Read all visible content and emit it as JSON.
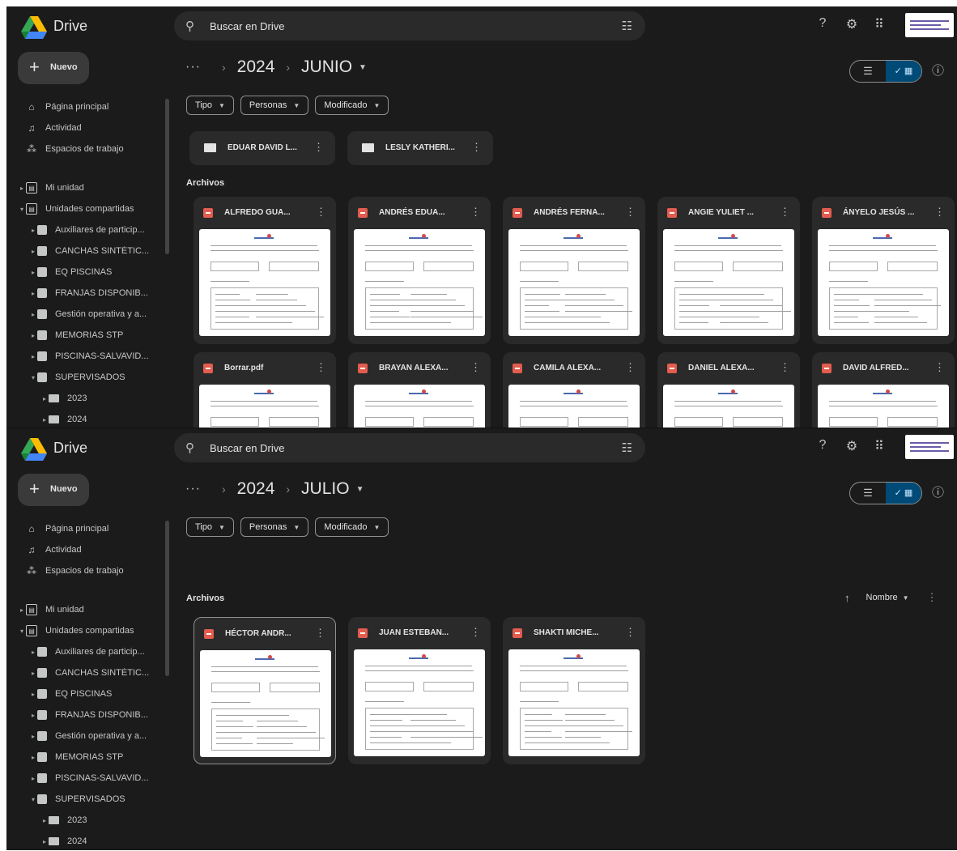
{
  "frames": [
    {
      "app_name": "Drive",
      "search_placeholder": "Buscar en Drive",
      "new_label": "Nuevo",
      "nav": [
        {
          "label": "Página principal"
        },
        {
          "label": "Actividad"
        },
        {
          "label": "Espacios de trabajo"
        }
      ],
      "my_drive": "Mi unidad",
      "shared_drives": "Unidades compartidas",
      "shared_items": [
        {
          "label": "Auxiliares de particip..."
        },
        {
          "label": "CANCHAS SINTÉTIC..."
        },
        {
          "label": "EQ PISCINAS"
        },
        {
          "label": "FRANJAS DISPONIB..."
        },
        {
          "label": "Gestión operativa y a..."
        },
        {
          "label": "MEMORIAS STP"
        },
        {
          "label": "PISCINAS-SALVAVID..."
        },
        {
          "label": "SUPERVISADOS"
        }
      ],
      "year_items": [
        {
          "label": "2023"
        },
        {
          "label": "2024"
        }
      ],
      "breadcrumb": {
        "more": "···",
        "year": "2024",
        "month": "JUNIO"
      },
      "filters": [
        {
          "label": "Tipo"
        },
        {
          "label": "Personas"
        },
        {
          "label": "Modificado"
        }
      ],
      "folders": [
        {
          "name": "EDUAR DAVID L..."
        },
        {
          "name": "LESLY KATHERI..."
        }
      ],
      "files_section": "Archivos",
      "files": [
        {
          "name": "ALFREDO GUA..."
        },
        {
          "name": "ANDRÉS EDUA..."
        },
        {
          "name": "ANDRÉS FERNA..."
        },
        {
          "name": "ANGIE YULIET ..."
        },
        {
          "name": "ÁNYELO JESÚS ..."
        },
        {
          "name": "Borrar.pdf"
        },
        {
          "name": "BRAYAN ALEXA..."
        },
        {
          "name": "CAMILA ALEXA..."
        },
        {
          "name": "DANIEL ALEXA..."
        },
        {
          "name": "DAVID ALFRED..."
        }
      ]
    },
    {
      "app_name": "Drive",
      "search_placeholder": "Buscar en Drive",
      "new_label": "Nuevo",
      "nav": [
        {
          "label": "Página principal"
        },
        {
          "label": "Actividad"
        },
        {
          "label": "Espacios de trabajo"
        }
      ],
      "my_drive": "Mi unidad",
      "shared_drives": "Unidades compartidas",
      "shared_items": [
        {
          "label": "Auxiliares de particip..."
        },
        {
          "label": "CANCHAS SINTÉTIC..."
        },
        {
          "label": "EQ PISCINAS"
        },
        {
          "label": "FRANJAS DISPONIB..."
        },
        {
          "label": "Gestión operativa y a..."
        },
        {
          "label": "MEMORIAS STP"
        },
        {
          "label": "PISCINAS-SALVAVID..."
        },
        {
          "label": "SUPERVISADOS"
        }
      ],
      "year_items": [
        {
          "label": "2023"
        },
        {
          "label": "2024"
        }
      ],
      "breadcrumb": {
        "more": "···",
        "year": "2024",
        "month": "JULIO"
      },
      "filters": [
        {
          "label": "Tipo"
        },
        {
          "label": "Personas"
        },
        {
          "label": "Modificado"
        }
      ],
      "files_section": "Archivos",
      "sort_label": "Nombre",
      "files": [
        {
          "name": "HÉCTOR ANDR..."
        },
        {
          "name": "JUAN ESTEBAN..."
        },
        {
          "name": "SHAKTI MICHE..."
        }
      ]
    }
  ],
  "colors": {
    "background": "#1b1b1b",
    "surface": "#2a2a2a",
    "text": "#e3e3e3",
    "pdf_icon": "#e25c4f",
    "view_toggle_active": "#004a77"
  },
  "icons": {
    "search": "search-icon",
    "tune": "tune-icon",
    "help": "help-icon",
    "settings": "gear-icon",
    "apps": "apps-grid-icon"
  }
}
